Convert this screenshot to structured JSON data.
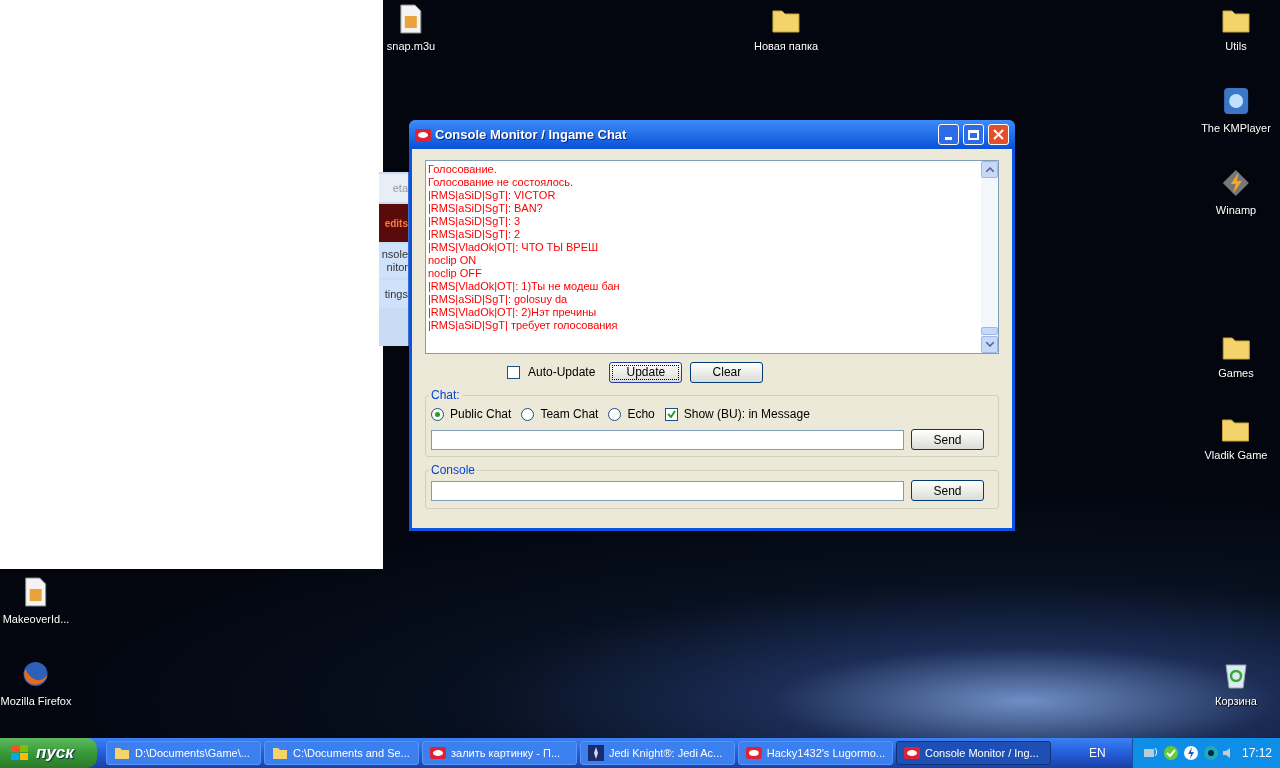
{
  "desktop_icons": [
    {
      "label": "snap.m3u",
      "kind": "file"
    },
    {
      "label": "Новая папка",
      "kind": "folder"
    },
    {
      "label": "Utils",
      "kind": "folder"
    },
    {
      "label": "The KMPlayer",
      "kind": "player"
    },
    {
      "label": "Winamp",
      "kind": "bolt"
    },
    {
      "label": "Games",
      "kind": "folder"
    },
    {
      "label": "Vladik Game",
      "kind": "folder"
    },
    {
      "label": "MakeoverId...",
      "kind": "file"
    },
    {
      "label": "Mozilla Firefox",
      "kind": "browser"
    },
    {
      "label": "Корзина",
      "kind": "bin"
    }
  ],
  "background_window": {
    "items": [
      {
        "label": "eta",
        "kind": "plain"
      },
      {
        "label": "edits",
        "kind": "banner"
      },
      {
        "label": "nsole\nnitor",
        "kind": "plain"
      },
      {
        "label": "tings",
        "kind": "plain"
      }
    ]
  },
  "window": {
    "title": "Console Monitor / Ingame Chat",
    "log": [
      "Голосование.",
      "Голосование не состоялось.",
      "|RMS|aSiD|SgT|: VICTOR",
      "|RMS|aSiD|SgT|: BAN?",
      "|RMS|aSiD|SgT|: 3",
      "|RMS|aSiD|SgT|: 2",
      "|RMS|VladOk|OT|: ЧТО ТЫ ВРЕШ",
      "noclip ON",
      "noclip OFF",
      "|RMS|VladOk|OT|: 1)Ты не модеш бан",
      "|RMS|aSiD|SgT|: golosuy da",
      "|RMS|VladOk|OT|: 2)Нэт пречины",
      "|RMS|aSiD|SgT| требует голосования"
    ],
    "auto_update": {
      "label": "Auto-Update",
      "checked": false
    },
    "buttons": [
      "Update",
      "Clear"
    ],
    "chat": {
      "title": "Chat:",
      "options": [
        {
          "label": "Public Chat",
          "kind": "radio",
          "selected": true
        },
        {
          "label": "Team Chat",
          "kind": "radio",
          "selected": false
        },
        {
          "label": "Echo",
          "kind": "radio",
          "selected": false
        },
        {
          "label": "Show (BU): in Message",
          "kind": "checkbox",
          "checked": true
        }
      ],
      "send": "Send"
    },
    "console": {
      "title": "Console",
      "send": "Send"
    }
  },
  "taskbar": {
    "start": "пуск",
    "tasks": [
      {
        "label": "D:\\Documents\\Game\\...",
        "kind": "folder",
        "selected": false
      },
      {
        "label": "C:\\Documents and Se...",
        "kind": "folder",
        "selected": false
      },
      {
        "label": "залить картинку - П...",
        "kind": "browser",
        "selected": false
      },
      {
        "label": "Jedi Knight®: Jedi Ac...",
        "kind": "game",
        "selected": false
      },
      {
        "label": "Hacky1432's Lugormo...",
        "kind": "app",
        "selected": false
      },
      {
        "label": "Console Monitor / Ing...",
        "kind": "app",
        "selected": true
      }
    ],
    "language": "EN",
    "clock": "17:12"
  }
}
